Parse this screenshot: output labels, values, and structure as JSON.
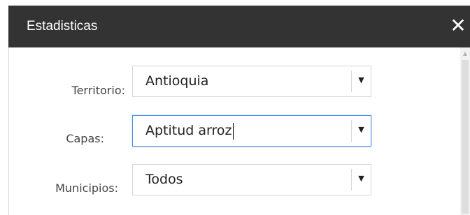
{
  "dialog": {
    "title": "Estadisticas",
    "close_icon": "close-icon",
    "close_glyph": "✕"
  },
  "form": {
    "territorio": {
      "label": "Territorio:",
      "value": "Antioquia"
    },
    "capas": {
      "label": "Capas:",
      "value": "Aptitud arroz"
    },
    "municipios": {
      "label": "Municipios:",
      "value": "Todos"
    }
  },
  "colors": {
    "titlebar": "#333333",
    "focus_border": "#4a90e2"
  }
}
